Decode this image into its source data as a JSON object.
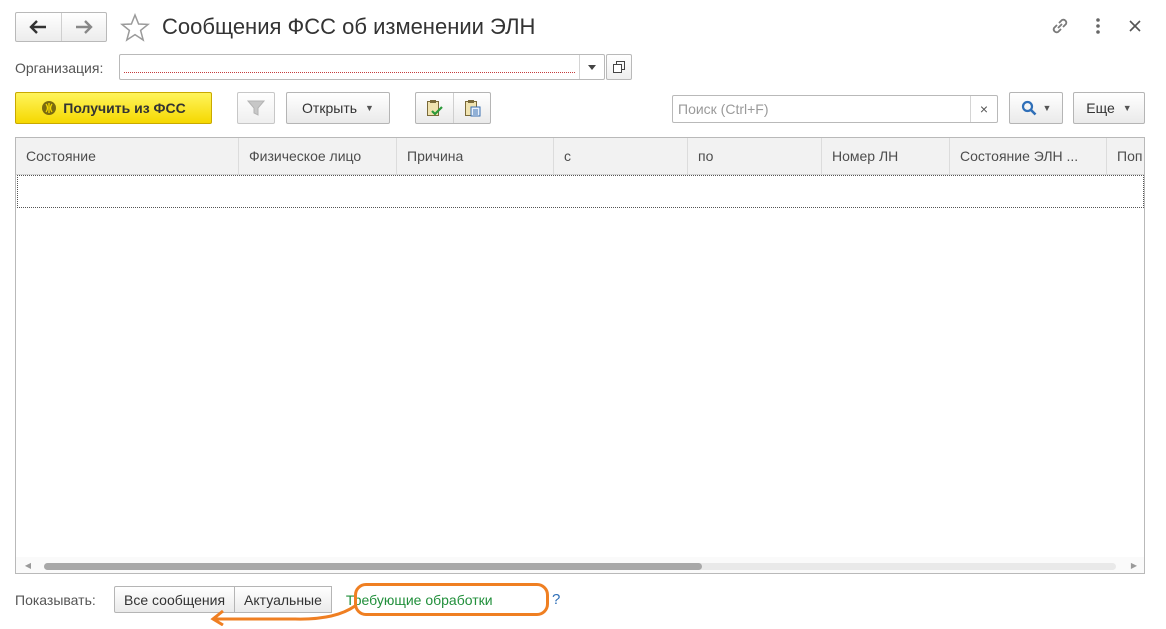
{
  "window": {
    "title": "Сообщения ФСС об изменении ЭЛН"
  },
  "header_icons": [
    "link-icon",
    "more-vert-icon",
    "close-icon"
  ],
  "organization": {
    "label": "Организация:",
    "value": ""
  },
  "toolbar": {
    "get_from_fss": "Получить из ФСС",
    "open": "Открыть",
    "search_placeholder": "Поиск (Ctrl+F)",
    "search_clear": "×",
    "more": "Еще"
  },
  "table": {
    "columns": [
      "Состояние",
      "Физическое лицо",
      "Причина",
      "с",
      "по",
      "Номер ЛН",
      "Состояние ЭЛН ...",
      "Поп"
    ],
    "rows": []
  },
  "filter": {
    "label": "Показывать:",
    "options": [
      "Все сообщения",
      "Актуальные",
      "Требующие обработки"
    ],
    "selected": "Требующие обработки",
    "help": "?"
  },
  "colors": {
    "accent_yellow": "#f5d800",
    "active_green": "#218f3b",
    "highlight_orange": "#ef7f22",
    "help_blue": "#2f6fb8"
  }
}
